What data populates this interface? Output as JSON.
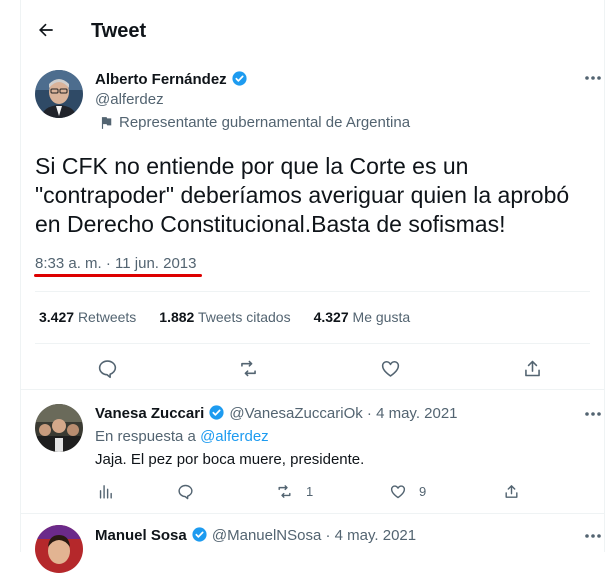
{
  "header": {
    "title": "Tweet"
  },
  "tweet": {
    "author_name": "Alberto Fernández",
    "author_handle": "@alferdez",
    "label": "Representante gubernamental de Argentina",
    "text": "Si CFK no entiende por que la Corte es un\n\"contrapoder\" deberíamos averiguar quien la aprobó\nen Derecho Constitucional.Basta de sofismas!",
    "timestamp": "8:33 a. m. · 11 jun. 2013"
  },
  "stats": {
    "retweets_count": "3.427",
    "retweets_label": "Retweets",
    "quotes_count": "1.882",
    "quotes_label": "Tweets citados",
    "likes_count": "4.327",
    "likes_label": "Me gusta"
  },
  "replies": [
    {
      "name": "Vanesa Zuccari",
      "handle": "@VanesaZuccariOk",
      "date": "· 4 may. 2021",
      "reply_prefix": "En respuesta a",
      "reply_to": "@alferdez",
      "text": "Jaja. El pez por boca muere, presidente.",
      "retweets": "1",
      "likes": "9"
    },
    {
      "name": "Manuel Sosa",
      "handle": "@ManuelNSosa",
      "date": "· 4 may. 2021"
    }
  ],
  "colors": {
    "accent": "#1d9bf0",
    "underline": "#dd0000",
    "secondary_text": "#536471"
  }
}
